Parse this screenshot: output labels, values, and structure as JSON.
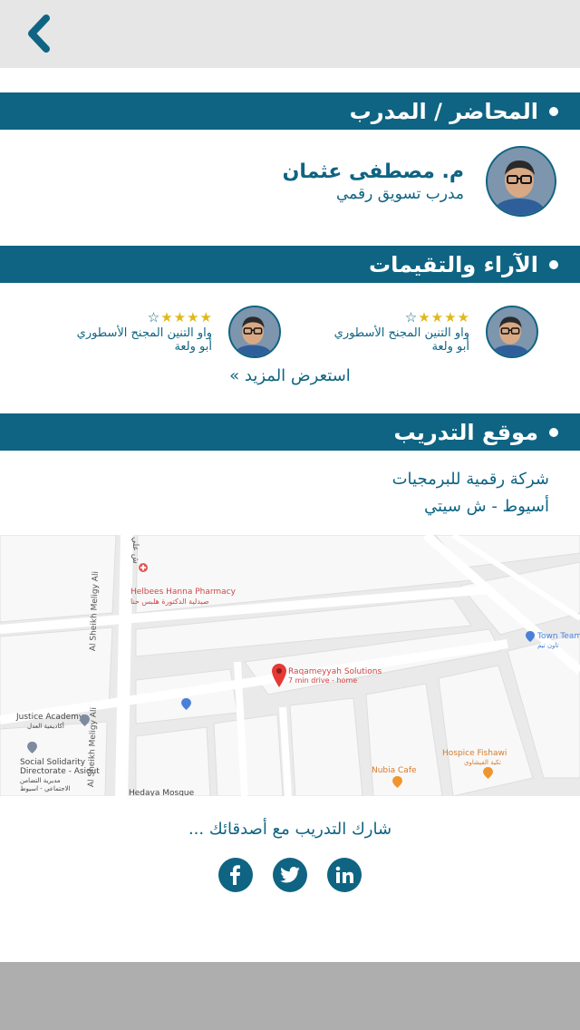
{
  "topbar": {
    "back_icon": "chevron-left-icon"
  },
  "colors": {
    "primary": "#0e6482",
    "star": "#e0b81a",
    "topbar": "#e6e6e6",
    "bottom": "#aeaeae"
  },
  "sections": {
    "trainer": "المحاضر / المدرب",
    "reviews": "الآراء والتقيمات",
    "location": "موقع التدريب"
  },
  "trainer": {
    "name": "م. مصطفى عثمان",
    "role": "مدرب تسويق رقمي"
  },
  "reviews": [
    {
      "text": "واو التنين المجنح الأسطوري",
      "user": "أبو ولعة",
      "rating": 4,
      "max": 5
    },
    {
      "text": "واو التنين المجنح الأسطوري",
      "user": "أبو ولعة",
      "rating": 4,
      "max": 5
    }
  ],
  "more_link": "استعرض المزيد »",
  "location": {
    "line1": "شركة رقمية للبرمجيات",
    "line2": "أسيوط - ش سيتي"
  },
  "map": {
    "pharmacy_en": "Helbees Hanna Pharmacy",
    "pharmacy_ar": "صيدلية الدكتورة هلبس حنا",
    "marker_title": "Raqameyyah Solutions",
    "marker_sub": "7 min drive - home",
    "town_team_en": "Town Team",
    "town_team_ar": "تاون تيم",
    "justice_en": "Justice Academy",
    "justice_ar": "أكاديمية العدل",
    "social_en_1": "Social Solidarity",
    "social_en_2": "Directorate - Asiout",
    "social_ar_1": "مديرية التضامن",
    "social_ar_2": "الاجتماعي - اسيوط",
    "hospice_en": "Hospice Fishawi",
    "hospice_ar": "تكية الفيشاوي",
    "nubia": "Nubia Cafe",
    "street_1": "Al Sheikh Meligy Ali",
    "street_2": "Al Sheikh Meligy Ali",
    "street_3": "ش علي",
    "mosque": "Hedaya Mosque"
  },
  "share": {
    "text": "شارك التدريب مع أصدقائك ...",
    "icons": [
      "facebook-icon",
      "twitter-icon",
      "linkedin-icon"
    ]
  }
}
